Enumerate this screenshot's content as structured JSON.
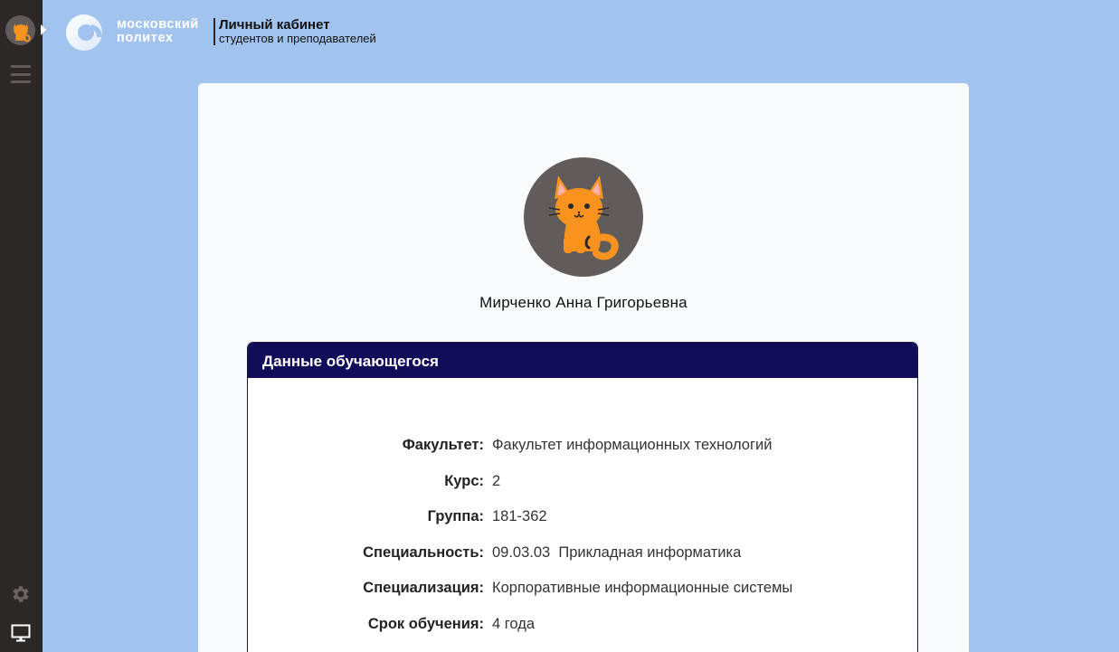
{
  "brand": {
    "logo_line1": "московский",
    "logo_line2": "политех",
    "cabinet_title": "Личный кабинет",
    "cabinet_subtitle": "студентов и преподавателей",
    "logo_color": "#ffffff"
  },
  "sidebar": {
    "avatar_icon": "cat-icon",
    "menu_icon": "hamburger-icon",
    "settings_icon": "gear-icon",
    "display_icon": "monitor-icon",
    "background": "#2c2827"
  },
  "profile": {
    "name": "Мирченко Анна Григорьевна",
    "photo_icon": "cat-icon"
  },
  "student_panel": {
    "title": "Данные обучающегося",
    "header_color": "#110d59",
    "rows": [
      {
        "label": "Факультет:",
        "value": "Факультет информационных технологий"
      },
      {
        "label": "Курс:",
        "value": "2"
      },
      {
        "label": "Группа:",
        "value": "181-362"
      },
      {
        "label": "Специальность:",
        "value": "09.03.03  Прикладная информатика"
      },
      {
        "label": "Специализация:",
        "value": "Корпоративные информационные системы"
      },
      {
        "label": "Срок обучения:",
        "value": "4 года"
      }
    ]
  },
  "colors": {
    "page_background": "#a1c3ee",
    "card_background": "#f8fafc"
  }
}
